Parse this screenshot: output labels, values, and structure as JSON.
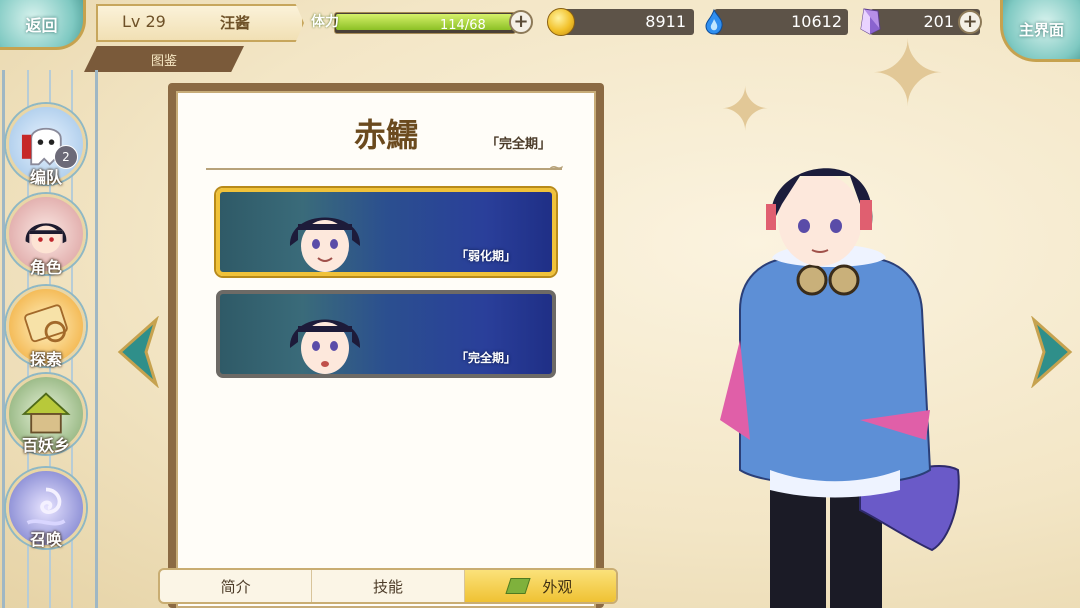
{
  "top_bar": {
    "back_label": "返回",
    "level": "Lv 29",
    "player_name": "汪酱",
    "section_tab": "图鉴",
    "stamina_label": "体力",
    "stamina_text": "114/68",
    "stamina_fraction": 1.0,
    "gold": "8911",
    "soul_fire": "10612",
    "crystal": "201",
    "home_label": "主界面"
  },
  "side_menu": {
    "items": [
      {
        "label": "编队",
        "badge": "2",
        "icon": "ghost-icon"
      },
      {
        "label": "角色",
        "icon": "character-portrait-icon"
      },
      {
        "label": "探索",
        "icon": "scroll-map-icon"
      },
      {
        "label": "百妖乡",
        "icon": "village-house-icon"
      },
      {
        "label": "召唤",
        "icon": "summon-swirl-icon"
      }
    ]
  },
  "panel": {
    "title": "赤鱬",
    "stage": "「完全期」",
    "skins": [
      {
        "label": "「弱化期」",
        "selected": true
      },
      {
        "label": "「完全期」",
        "selected": false
      }
    ]
  },
  "tabs": [
    {
      "label": "简介",
      "active": false
    },
    {
      "label": "技能",
      "active": false
    },
    {
      "label": "外观",
      "active": true
    }
  ],
  "colors": {
    "accent_gold": "#f0c23a",
    "panel_brown": "#8b6a43",
    "teal_button": "#7fc9c2"
  }
}
